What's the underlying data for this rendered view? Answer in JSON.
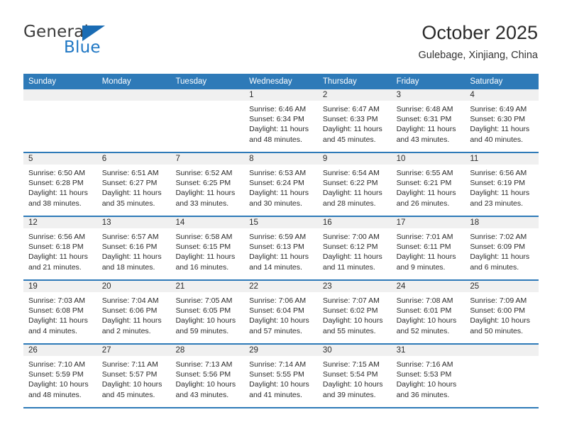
{
  "brand": {
    "name_part1": "General",
    "name_part2": "Blue",
    "triangle_color": "#1a6cb4",
    "blue_color": "#1f77c4"
  },
  "header": {
    "title": "October 2025",
    "subtitle": "Gulebage, Xinjiang, China"
  },
  "theme": {
    "header_blue": "#2e7ab8",
    "daynum_band": "#f0f0f0",
    "text": "#2b2b2b"
  },
  "weekdays": [
    "Sunday",
    "Monday",
    "Tuesday",
    "Wednesday",
    "Thursday",
    "Friday",
    "Saturday"
  ],
  "weeks": [
    [
      {
        "day": "",
        "lines": []
      },
      {
        "day": "",
        "lines": []
      },
      {
        "day": "",
        "lines": []
      },
      {
        "day": "1",
        "lines": [
          "Sunrise: 6:46 AM",
          "Sunset: 6:34 PM",
          "Daylight: 11 hours",
          "and 48 minutes."
        ]
      },
      {
        "day": "2",
        "lines": [
          "Sunrise: 6:47 AM",
          "Sunset: 6:33 PM",
          "Daylight: 11 hours",
          "and 45 minutes."
        ]
      },
      {
        "day": "3",
        "lines": [
          "Sunrise: 6:48 AM",
          "Sunset: 6:31 PM",
          "Daylight: 11 hours",
          "and 43 minutes."
        ]
      },
      {
        "day": "4",
        "lines": [
          "Sunrise: 6:49 AM",
          "Sunset: 6:30 PM",
          "Daylight: 11 hours",
          "and 40 minutes."
        ]
      }
    ],
    [
      {
        "day": "5",
        "lines": [
          "Sunrise: 6:50 AM",
          "Sunset: 6:28 PM",
          "Daylight: 11 hours",
          "and 38 minutes."
        ]
      },
      {
        "day": "6",
        "lines": [
          "Sunrise: 6:51 AM",
          "Sunset: 6:27 PM",
          "Daylight: 11 hours",
          "and 35 minutes."
        ]
      },
      {
        "day": "7",
        "lines": [
          "Sunrise: 6:52 AM",
          "Sunset: 6:25 PM",
          "Daylight: 11 hours",
          "and 33 minutes."
        ]
      },
      {
        "day": "8",
        "lines": [
          "Sunrise: 6:53 AM",
          "Sunset: 6:24 PM",
          "Daylight: 11 hours",
          "and 30 minutes."
        ]
      },
      {
        "day": "9",
        "lines": [
          "Sunrise: 6:54 AM",
          "Sunset: 6:22 PM",
          "Daylight: 11 hours",
          "and 28 minutes."
        ]
      },
      {
        "day": "10",
        "lines": [
          "Sunrise: 6:55 AM",
          "Sunset: 6:21 PM",
          "Daylight: 11 hours",
          "and 26 minutes."
        ]
      },
      {
        "day": "11",
        "lines": [
          "Sunrise: 6:56 AM",
          "Sunset: 6:19 PM",
          "Daylight: 11 hours",
          "and 23 minutes."
        ]
      }
    ],
    [
      {
        "day": "12",
        "lines": [
          "Sunrise: 6:56 AM",
          "Sunset: 6:18 PM",
          "Daylight: 11 hours",
          "and 21 minutes."
        ]
      },
      {
        "day": "13",
        "lines": [
          "Sunrise: 6:57 AM",
          "Sunset: 6:16 PM",
          "Daylight: 11 hours",
          "and 18 minutes."
        ]
      },
      {
        "day": "14",
        "lines": [
          "Sunrise: 6:58 AM",
          "Sunset: 6:15 PM",
          "Daylight: 11 hours",
          "and 16 minutes."
        ]
      },
      {
        "day": "15",
        "lines": [
          "Sunrise: 6:59 AM",
          "Sunset: 6:13 PM",
          "Daylight: 11 hours",
          "and 14 minutes."
        ]
      },
      {
        "day": "16",
        "lines": [
          "Sunrise: 7:00 AM",
          "Sunset: 6:12 PM",
          "Daylight: 11 hours",
          "and 11 minutes."
        ]
      },
      {
        "day": "17",
        "lines": [
          "Sunrise: 7:01 AM",
          "Sunset: 6:11 PM",
          "Daylight: 11 hours",
          "and 9 minutes."
        ]
      },
      {
        "day": "18",
        "lines": [
          "Sunrise: 7:02 AM",
          "Sunset: 6:09 PM",
          "Daylight: 11 hours",
          "and 6 minutes."
        ]
      }
    ],
    [
      {
        "day": "19",
        "lines": [
          "Sunrise: 7:03 AM",
          "Sunset: 6:08 PM",
          "Daylight: 11 hours",
          "and 4 minutes."
        ]
      },
      {
        "day": "20",
        "lines": [
          "Sunrise: 7:04 AM",
          "Sunset: 6:06 PM",
          "Daylight: 11 hours",
          "and 2 minutes."
        ]
      },
      {
        "day": "21",
        "lines": [
          "Sunrise: 7:05 AM",
          "Sunset: 6:05 PM",
          "Daylight: 10 hours",
          "and 59 minutes."
        ]
      },
      {
        "day": "22",
        "lines": [
          "Sunrise: 7:06 AM",
          "Sunset: 6:04 PM",
          "Daylight: 10 hours",
          "and 57 minutes."
        ]
      },
      {
        "day": "23",
        "lines": [
          "Sunrise: 7:07 AM",
          "Sunset: 6:02 PM",
          "Daylight: 10 hours",
          "and 55 minutes."
        ]
      },
      {
        "day": "24",
        "lines": [
          "Sunrise: 7:08 AM",
          "Sunset: 6:01 PM",
          "Daylight: 10 hours",
          "and 52 minutes."
        ]
      },
      {
        "day": "25",
        "lines": [
          "Sunrise: 7:09 AM",
          "Sunset: 6:00 PM",
          "Daylight: 10 hours",
          "and 50 minutes."
        ]
      }
    ],
    [
      {
        "day": "26",
        "lines": [
          "Sunrise: 7:10 AM",
          "Sunset: 5:59 PM",
          "Daylight: 10 hours",
          "and 48 minutes."
        ]
      },
      {
        "day": "27",
        "lines": [
          "Sunrise: 7:11 AM",
          "Sunset: 5:57 PM",
          "Daylight: 10 hours",
          "and 45 minutes."
        ]
      },
      {
        "day": "28",
        "lines": [
          "Sunrise: 7:13 AM",
          "Sunset: 5:56 PM",
          "Daylight: 10 hours",
          "and 43 minutes."
        ]
      },
      {
        "day": "29",
        "lines": [
          "Sunrise: 7:14 AM",
          "Sunset: 5:55 PM",
          "Daylight: 10 hours",
          "and 41 minutes."
        ]
      },
      {
        "day": "30",
        "lines": [
          "Sunrise: 7:15 AM",
          "Sunset: 5:54 PM",
          "Daylight: 10 hours",
          "and 39 minutes."
        ]
      },
      {
        "day": "31",
        "lines": [
          "Sunrise: 7:16 AM",
          "Sunset: 5:53 PM",
          "Daylight: 10 hours",
          "and 36 minutes."
        ]
      },
      {
        "day": "",
        "lines": []
      }
    ]
  ]
}
